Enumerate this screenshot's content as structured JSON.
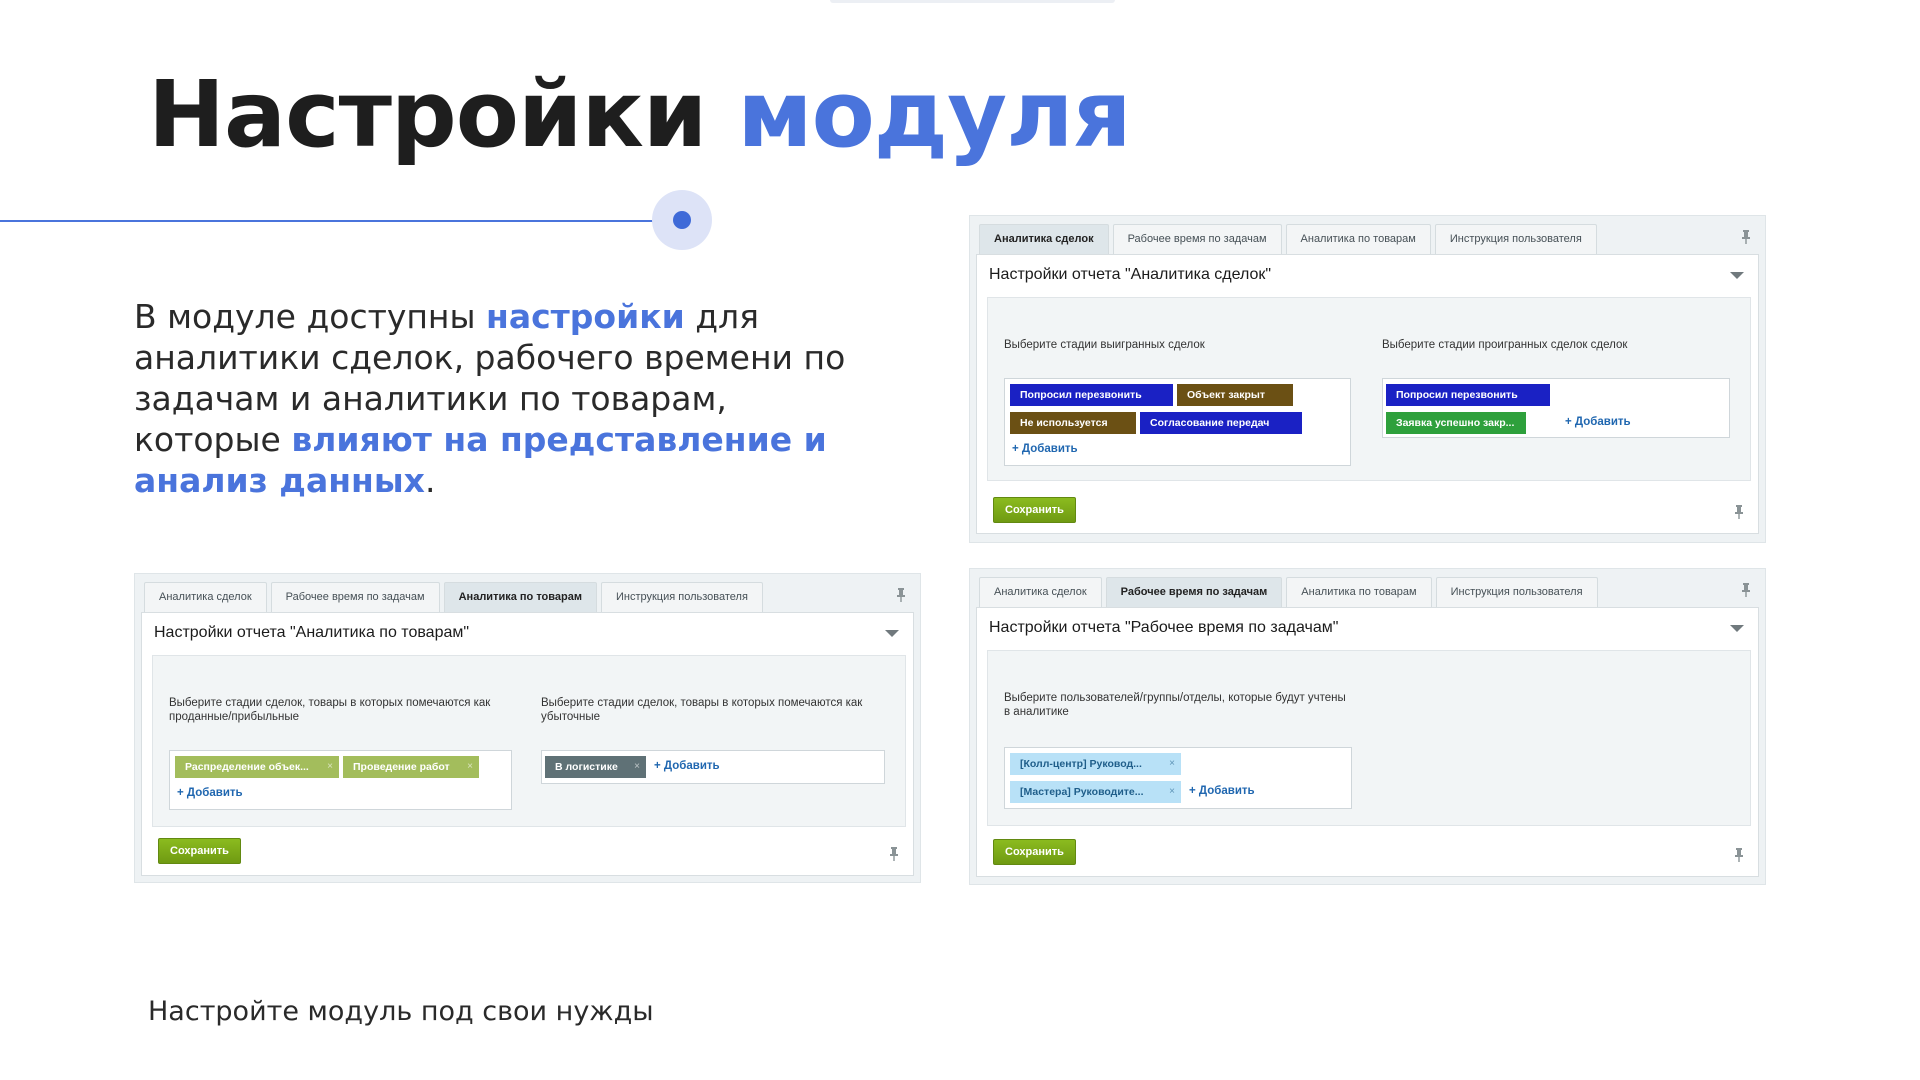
{
  "slide": {
    "title_main": "Настройки",
    "title_accent": "модуля",
    "desc_part1": "В модуле доступны ",
    "desc_bold1": "настройки",
    "desc_part2": " для аналитики сделок, рабочего времени по задачам и аналитики по товарам, которые ",
    "desc_bold2": "влияют на представление и анализ данных",
    "desc_part3": ".",
    "footer": "Настройте модуль под свои нужды"
  },
  "tabs": [
    "Аналитика сделок",
    "Рабочее время по задачам",
    "Аналитика по товарам",
    "Инструкция пользователя"
  ],
  "save_label": "Сохранить",
  "add_label": "+ Добавить",
  "panel_deals": {
    "header": "Настройки отчета \"Аналитика сделок\"",
    "won_label": "Выберите стадии выигранных сделок",
    "lost_label": "Выберите стадии проигранных сделок сделок",
    "won_tags": [
      "Попросил перезвонить",
      "Объект закрыт",
      "Не используется",
      "Согласование передач"
    ],
    "lost_tags": [
      "Попросил перезвонить",
      "Заявка успешно закр..."
    ]
  },
  "panel_goods": {
    "header": "Настройки отчета \"Аналитика по товарам\"",
    "sold_label": "Выберите стадии сделок, товары в которых помечаются как проданные/прибыльные",
    "loss_label": "Выберите стадии сделок, товары в которых помечаются как убыточные",
    "sold_tags": [
      "Распределение объек...",
      "Проведение работ"
    ],
    "loss_tags": [
      "В логистике"
    ]
  },
  "panel_worktime": {
    "header": "Настройки отчета \"Рабочее время по задачам\"",
    "users_label": "Выберите пользователей/группы/отделы, которые будут учтены в аналитике",
    "user_tags": [
      "[Колл-центр] Руковод...",
      "[Мастера] Руководите..."
    ]
  },
  "colors": {
    "accent": "#4a74dc",
    "tag_blue": "#1a21c4",
    "tag_brown": "#6b5014",
    "tag_green": "#2ea03c",
    "tag_olive": "#a3bd5c",
    "tag_slate": "#5f7176",
    "tag_lightblue": "#b8e1f7",
    "save_green": "#7aa819"
  },
  "icons": [
    "pin-icon",
    "chevron-down-icon",
    "close-icon"
  ]
}
